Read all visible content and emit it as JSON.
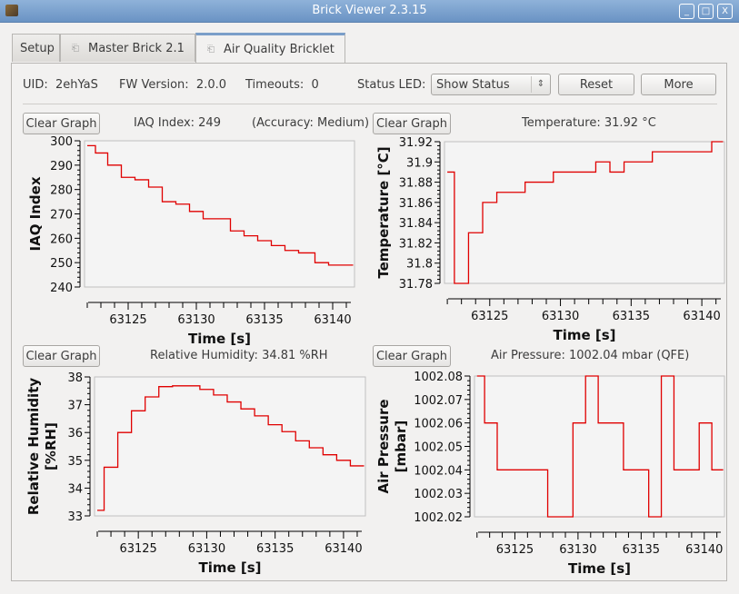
{
  "window": {
    "title": "Brick Viewer 2.3.15",
    "buttons": [
      "minimize",
      "maximize",
      "close"
    ]
  },
  "tabs": [
    {
      "label": "Setup",
      "icon": "",
      "active": false
    },
    {
      "label": "Master Brick 2.1",
      "icon": "detach-icon",
      "active": false
    },
    {
      "label": "Air Quality Bricklet",
      "icon": "detach-icon",
      "active": true
    }
  ],
  "info": {
    "uid_label": "UID:",
    "uid": "2ehYaS",
    "fw_label": "FW Version:",
    "fw": "2.0.0",
    "timeouts_label": "Timeouts:",
    "timeouts": "0",
    "status_led_label": "Status LED:",
    "status_led_value": "Show Status",
    "reset_label": "Reset",
    "more_label": "More"
  },
  "graphs": [
    {
      "clear_label": "Clear Graph",
      "header": "IAQ Index: 249",
      "header2": "(Accuracy: Medium)"
    },
    {
      "clear_label": "Clear Graph",
      "header": "Temperature: 31.92 °C"
    },
    {
      "clear_label": "Clear Graph",
      "header": "Relative Humidity: 34.81 %RH"
    },
    {
      "clear_label": "Clear Graph",
      "header": "Air Pressure: 1002.04 mbar (QFE)"
    }
  ],
  "colors": {
    "line": "#e00000",
    "plot_bg": "#f4f4f4",
    "plot_border": "#c0c0c0"
  },
  "chart_data": [
    {
      "type": "line",
      "title": "",
      "xlabel": "Time [s]",
      "ylabel": [
        "IAQ Index"
      ],
      "xlim": [
        63121.8,
        63141.6
      ],
      "ylim": [
        240,
        300
      ],
      "xticks": [
        63125,
        63130,
        63135,
        63140
      ],
      "yticks": [
        240,
        250,
        260,
        270,
        280,
        290,
        300
      ],
      "yticks_labels": [
        "240",
        "250",
        "260",
        "270",
        "280",
        "290",
        "300"
      ],
      "step": true,
      "x": [
        63122.0,
        63122.6,
        63123.5,
        63124.5,
        63125.5,
        63126.5,
        63127.5,
        63128.5,
        63129.5,
        63130.5,
        63132.5,
        63133.5,
        63134.5,
        63135.5,
        63136.5,
        63137.5,
        63138.7,
        63139.7,
        63141.5
      ],
      "values": [
        298,
        295,
        290,
        285,
        284,
        281,
        275,
        274,
        271,
        268,
        263,
        261,
        259,
        257,
        255,
        254,
        250,
        249,
        249
      ]
    },
    {
      "type": "line",
      "title": "",
      "xlabel": "Time [s]",
      "ylabel": [
        "Temperature [°C]"
      ],
      "xlim": [
        63121.8,
        63141.6
      ],
      "ylim": [
        31.78,
        31.92
      ],
      "xticks": [
        63125,
        63130,
        63135,
        63140
      ],
      "yticks": [
        31.78,
        31.8,
        31.82,
        31.84,
        31.86,
        31.88,
        31.9,
        31.92
      ],
      "yticks_labels": [
        "31.78",
        "31.8",
        "31.82",
        "31.84",
        "31.86",
        "31.88",
        "31.9",
        "31.92"
      ],
      "step": true,
      "x": [
        63122.0,
        63122.5,
        63123.5,
        63124.5,
        63125.5,
        63127.5,
        63129.5,
        63132.5,
        63133.5,
        63134.5,
        63136.5,
        63140.7,
        63141.5
      ],
      "values": [
        31.89,
        31.78,
        31.83,
        31.86,
        31.87,
        31.88,
        31.89,
        31.9,
        31.89,
        31.9,
        31.91,
        31.92,
        31.92
      ]
    },
    {
      "type": "line",
      "title": "",
      "xlabel": "Time [s]",
      "ylabel": [
        "Relative Humidity",
        "[%RH]"
      ],
      "xlim": [
        63121.8,
        63141.6
      ],
      "ylim": [
        33,
        38
      ],
      "xticks": [
        63125,
        63130,
        63135,
        63140
      ],
      "yticks": [
        33,
        34,
        35,
        36,
        37,
        38
      ],
      "yticks_labels": [
        "33",
        "34",
        "35",
        "36",
        "37",
        "38"
      ],
      "step": true,
      "x": [
        63122.0,
        63122.5,
        63123.5,
        63124.5,
        63125.5,
        63126.5,
        63127.5,
        63129.5,
        63130.5,
        63131.5,
        63132.5,
        63133.5,
        63134.5,
        63135.5,
        63136.5,
        63137.5,
        63138.5,
        63139.5,
        63140.5,
        63141.5
      ],
      "values": [
        33.2,
        34.75,
        36.0,
        36.78,
        37.28,
        37.65,
        37.68,
        37.55,
        37.35,
        37.1,
        36.85,
        36.6,
        36.28,
        36.03,
        35.7,
        35.45,
        35.2,
        35.0,
        34.8,
        34.8
      ]
    },
    {
      "type": "line",
      "title": "",
      "xlabel": "Time [s]",
      "ylabel": [
        "Air Pressure",
        "[mbar]"
      ],
      "xlim": [
        63121.8,
        63141.6
      ],
      "ylim": [
        1002.02,
        1002.08
      ],
      "xticks": [
        63125,
        63130,
        63135,
        63140
      ],
      "yticks": [
        1002.02,
        1002.03,
        1002.04,
        1002.05,
        1002.06,
        1002.07,
        1002.08
      ],
      "yticks_labels": [
        "1002.02",
        "1002.03",
        "1002.04",
        "1002.05",
        "1002.06",
        "1002.07",
        "1002.08"
      ],
      "step": true,
      "x": [
        63122.0,
        63122.6,
        63123.6,
        63127.6,
        63129.6,
        63130.6,
        63131.6,
        63133.6,
        63135.6,
        63136.6,
        63137.6,
        63139.6,
        63140.6,
        63141.5
      ],
      "values": [
        1002.08,
        1002.06,
        1002.04,
        1002.02,
        1002.06,
        1002.08,
        1002.06,
        1002.04,
        1002.02,
        1002.08,
        1002.04,
        1002.06,
        1002.04,
        1002.04
      ]
    }
  ]
}
